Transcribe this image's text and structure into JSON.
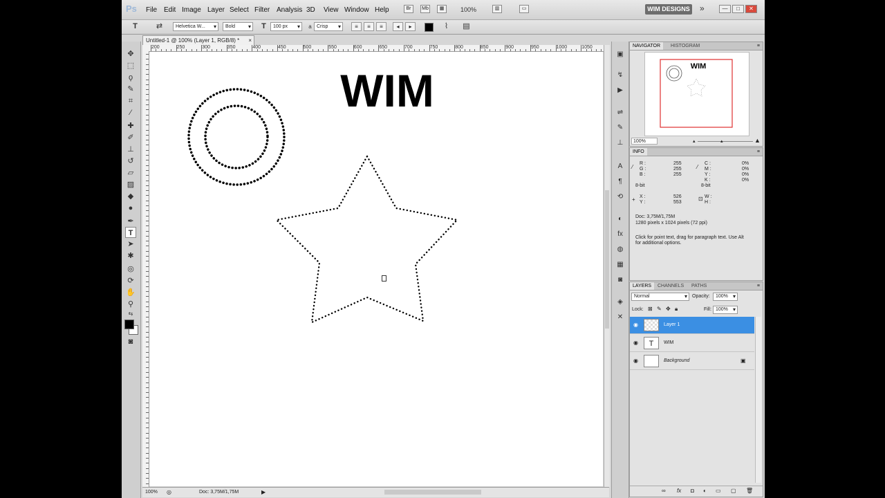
{
  "menubar": {
    "logo": "Ps",
    "items": [
      "File",
      "Edit",
      "Image",
      "Layer",
      "Select",
      "Filter",
      "Analysis",
      "3D",
      "View",
      "Window",
      "Help"
    ],
    "zoom": "100%",
    "workspace": "WIM DESIGNS",
    "minimize": "—",
    "restore": "□",
    "close": "✕"
  },
  "options": {
    "font_family": "Helvetica W...",
    "font_style": "Bold",
    "font_size": "100 px",
    "antialias": "Crisp"
  },
  "document": {
    "tab_title": "Untitled-1 @ 100% (Layer 1, RGB/8) *",
    "tab_close": "×",
    "ruler_labels": [
      "200",
      "250",
      "300",
      "350",
      "400",
      "450",
      "500",
      "550",
      "600",
      "650",
      "700",
      "750",
      "800",
      "850",
      "900",
      "950",
      "1000",
      "1050"
    ],
    "canvas_text": "WIM",
    "status_zoom": "100%",
    "status_doc": "Doc: 3,75M/1,75M"
  },
  "navigator": {
    "tabs": [
      "NAVIGATOR",
      "HISTOGRAM"
    ],
    "zoom": "100%",
    "thumb_text": "WIM"
  },
  "info": {
    "tab": "INFO",
    "r_label": "R :",
    "r": "255",
    "g_label": "G :",
    "g": "255",
    "b_label": "B :",
    "b": "255",
    "bits1": "8-bit",
    "c_label": "C :",
    "c": "0%",
    "m_label": "M :",
    "m": "0%",
    "y_label": "Y :",
    "y": "0%",
    "k_label": "K :",
    "k": "0%",
    "bits2": "8-bit",
    "x_label": "X :",
    "x": "526",
    "y2_label": "Y :",
    "y2": "553",
    "w_label": "W :",
    "h_label": "H :",
    "doc": "Doc: 3,75M/1,75M",
    "dims": "1280 pixels x 1024 pixels (72 ppi)",
    "hint_line1": "Click for point text, drag for paragraph text. Use Alt",
    "hint_line2": "for additional options."
  },
  "layers": {
    "tabs": [
      "LAYERS",
      "CHANNELS",
      "PATHS"
    ],
    "blend_mode": "Normal",
    "opacity_label": "Opacity:",
    "opacity": "100%",
    "lock_label": "Lock:",
    "fill_label": "Fill:",
    "fill": "100%",
    "items": [
      {
        "name": "Layer 1",
        "thumb": ""
      },
      {
        "name": "WIM",
        "thumb": "T"
      },
      {
        "name": "Background",
        "thumb": ""
      }
    ]
  },
  "colors": {
    "selection": "#3b8fe3",
    "nav_frame": "#e03030"
  }
}
